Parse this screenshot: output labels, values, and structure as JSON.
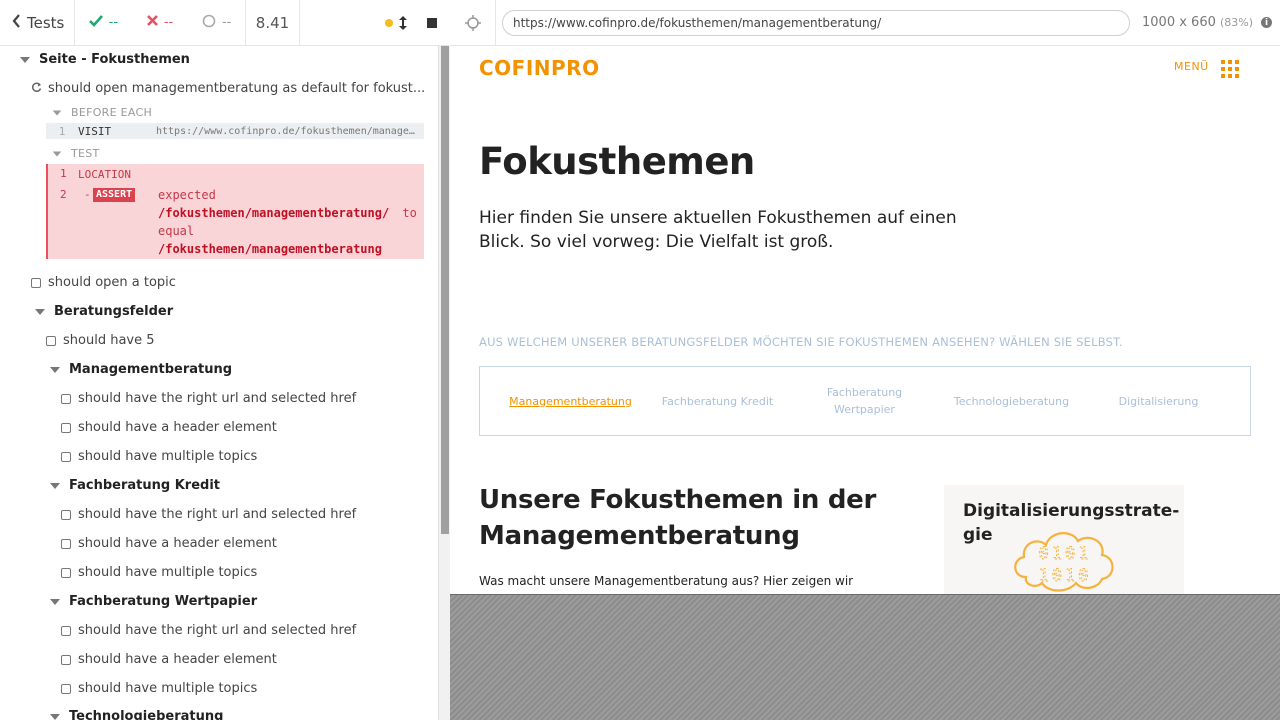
{
  "topbar": {
    "tests_label": "Tests",
    "passed": "--",
    "failed": "--",
    "pending": "--",
    "duration": "8.41"
  },
  "aut_header": {
    "url": "https://www.cofinpro.de/fokusthemen/managementberatung/",
    "viewport": "1000 x 660",
    "scale": "(83%)"
  },
  "reporter": {
    "suite_root": "Seite - Fokusthemen",
    "test_default": "should open managementberatung as default for fokust...",
    "before_each_label": "BEFORE EACH",
    "visit": {
      "num": "1",
      "name": "VISIT",
      "message": "https://www.cofinpro.de/fokusthemen/managementberatung/"
    },
    "test_label": "TEST",
    "location": {
      "num": "1",
      "name": "LOCATION"
    },
    "assert": {
      "num": "2",
      "dash": "-",
      "badge": "ASSERT",
      "expected": "expected",
      "actual": "/fokusthemen/managementberatung/",
      "to_equal_1": "to",
      "to_equal_2": "equal",
      "target": "/fokusthemen/managementberatung"
    },
    "test_open_topic": "should open a topic",
    "suite_beratung": "Beratungsfelder",
    "test_have5": "should have 5",
    "groups": [
      {
        "title": "Managementberatung",
        "tests": [
          "should have the right url and selected href",
          "should have a header element",
          "should have multiple topics"
        ]
      },
      {
        "title": "Fachberatung Kredit",
        "tests": [
          "should have the right url and selected href",
          "should have a header element",
          "should have multiple topics"
        ]
      },
      {
        "title": "Fachberatung Wertpapier",
        "tests": [
          "should have the right url and selected href",
          "should have a header element",
          "should have multiple topics"
        ]
      },
      {
        "title": "Technologieberatung",
        "tests": []
      }
    ]
  },
  "site": {
    "logo": "COFINPRO",
    "menu": "MENÜ",
    "heading": "Fokusthemen",
    "intro": "Hier finden Sie unsere aktuellen Fokusthemen auf einen Blick. So viel vorweg: Die Vielfalt ist groß.",
    "choose": "AUS WELCHEM UNSERER BERATUNGSFELDER MÖCHTEN SIE FOKUSTHEMEN ANSEHEN? WÄHLEN SIE SELBST.",
    "tabs": [
      "Managementberatung",
      "Fachberatung Kredit",
      "Fachberatung\nWertpapier",
      "Technologieberatung",
      "Digitalisierung"
    ],
    "sub_heading": "Unsere Fokusthemen in der Managementberatung",
    "body_text": "Was macht unsere Managementberatung aus? Hier zeigen wir",
    "card_title": "Digitalisierungsstrate-\ngie",
    "card_digits_1": "0101",
    "card_digits_2": "1010"
  },
  "colors": {
    "accent_orange": "#f39200",
    "fail_red": "#e94f5f",
    "pass_green": "#1fa971",
    "link_blue": "#a9bfd8"
  }
}
